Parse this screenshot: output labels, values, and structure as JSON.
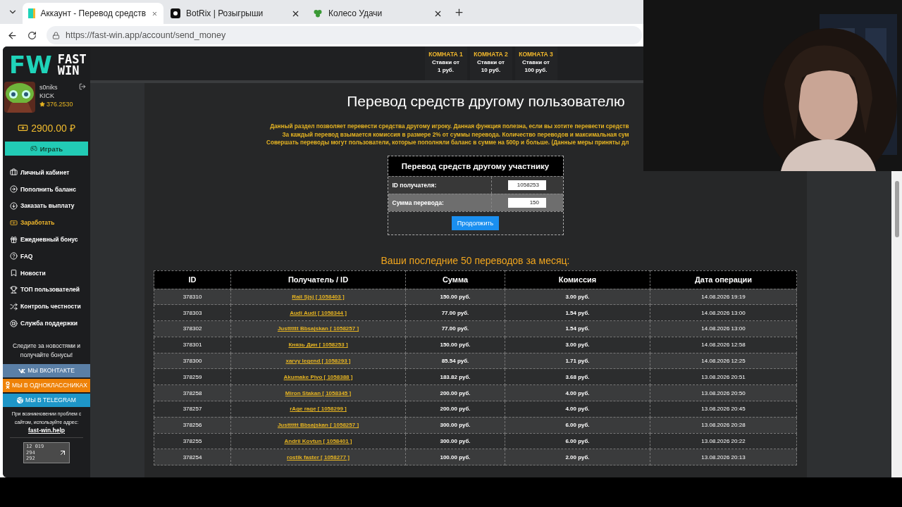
{
  "browser": {
    "tabs": [
      {
        "title": "Аккаунт - Перевод средств",
        "selected": true,
        "kind": "fw"
      },
      {
        "title": "BotRix | Розыгрыши",
        "selected": false,
        "kind": "botrix"
      },
      {
        "title": "Колесо Удачи",
        "selected": false,
        "kind": "clover"
      }
    ],
    "address": "https://fast-win.app/account/send_money"
  },
  "sidebar": {
    "logo": {
      "mark": "FW",
      "line1": "FAST",
      "line2": "WIN"
    },
    "user": {
      "name": "s0niks",
      "platform": "KICK",
      "rating": "376.2530"
    },
    "balance": "2900.00 ₽",
    "play_button": "Играть",
    "menu": [
      {
        "label": "Личный кабинет",
        "selected": false
      },
      {
        "label": "Пополнить баланс",
        "selected": false
      },
      {
        "label": "Заказать выплату",
        "selected": false
      },
      {
        "label": "Заработать",
        "selected": true
      },
      {
        "label": "Ежедневный бонус",
        "selected": false
      },
      {
        "label": "FAQ",
        "selected": false
      },
      {
        "label": "Новости",
        "selected": false
      },
      {
        "label": "ТОП пользователей",
        "selected": false
      },
      {
        "label": "Контроль честности",
        "selected": false
      },
      {
        "label": "Служба поддержки",
        "selected": false
      }
    ],
    "follow_text": "Следите за новостями и получайте бонусы!",
    "socials": [
      {
        "label": "МЫ ВКОНТАКТЕ",
        "kind": "vk",
        "color": "#5a7fa6"
      },
      {
        "label": "МЫ В ОДНОКЛАССНИКАХ",
        "kind": "ok",
        "color": "#ee8208"
      },
      {
        "label": "МЫ В TELEGRAM",
        "kind": "tg",
        "color": "#1e96c8"
      }
    ],
    "help_text": "При возникновении проблем с сайтом, используйте адрес:",
    "help_link": "fast-win.help",
    "counter": [
      "12 019",
      "294",
      "292"
    ]
  },
  "rooms": [
    {
      "title": "КОМНАТА 1",
      "line1": "Ставки от",
      "line2": "1 руб."
    },
    {
      "title": "КОМНАТА 2",
      "line1": "Ставки от",
      "line2": "10 руб."
    },
    {
      "title": "КОМНАТА 3",
      "line1": "Ставки от",
      "line2": "100 руб."
    }
  ],
  "page_title": "Перевод средств другому пользователю",
  "notice": [
    "Данный раздел позволяет перевести средства другому игроку. Данная функция полезна, если вы хотите перевести средств",
    "За каждый перевод взымается комиссия в размере 2% от суммы перевода. Количество переводов и максимальная сум",
    "Совершать переводы могут пользователи, которые пополняли баланс в сумме на 500р и больше. (Данные меры приняты дл"
  ],
  "form": {
    "title": "Перевод средств другому участнику",
    "fields": [
      {
        "label": "ID получателя:",
        "value": "1058253",
        "highlighted": false
      },
      {
        "label": "Сумма перевода:",
        "value": "150",
        "highlighted": true
      }
    ],
    "submit": "Продолжить"
  },
  "history": {
    "title": "Ваши последние 50 переводов за месяц:",
    "columns": [
      "ID",
      "Получатель / ID",
      "Сумма",
      "Комиссия",
      "Дата операции"
    ],
    "rows": [
      [
        "378310",
        "Rail Sjsj [ 1058403 ]",
        "150.00 руб.",
        "3.00 руб.",
        "14.08.2026 19:19"
      ],
      [
        "378303",
        "Audi Audi [ 1058344 ]",
        "77.00 руб.",
        "1.54 руб.",
        "14.08.2026 13:00"
      ],
      [
        "378302",
        "Justttttt Bbsajskan [ 1058257 ]",
        "77.00 руб.",
        "1.54 руб.",
        "14.08.2026 13:00"
      ],
      [
        "378301",
        "Князь Дин [ 1058253 ]",
        "150.00 руб.",
        "3.00 руб.",
        "14.08.2026 12:58"
      ],
      [
        "378300",
        "xarvy legend [ 1058293 ]",
        "85.54 руб.",
        "1.71 руб.",
        "14.08.2026 12:25"
      ],
      [
        "378259",
        "Akumake Pivo [ 1058388 ]",
        "183.82 руб.",
        "3.68 руб.",
        "13.08.2026 20:51"
      ],
      [
        "378258",
        "Miron Stakan [ 1058345 ]",
        "200.00 руб.",
        "4.00 руб.",
        "13.08.2026 20:50"
      ],
      [
        "378257",
        "rAge rage [ 1058299 ]",
        "200.00 руб.",
        "4.00 руб.",
        "13.08.2026 20:45"
      ],
      [
        "378256",
        "Justttttt Bbsajskan [ 1058257 ]",
        "300.00 руб.",
        "6.00 руб.",
        "13.08.2026 20:28"
      ],
      [
        "378255",
        "Andrii Kovtun [ 1058401 ]",
        "300.00 руб.",
        "6.00 руб.",
        "13.08.2026 20:22"
      ],
      [
        "378254",
        "rostik faster [ 1058277 ]",
        "100.00 руб.",
        "2.00 руб.",
        "13.08.2026 20:13"
      ]
    ]
  }
}
